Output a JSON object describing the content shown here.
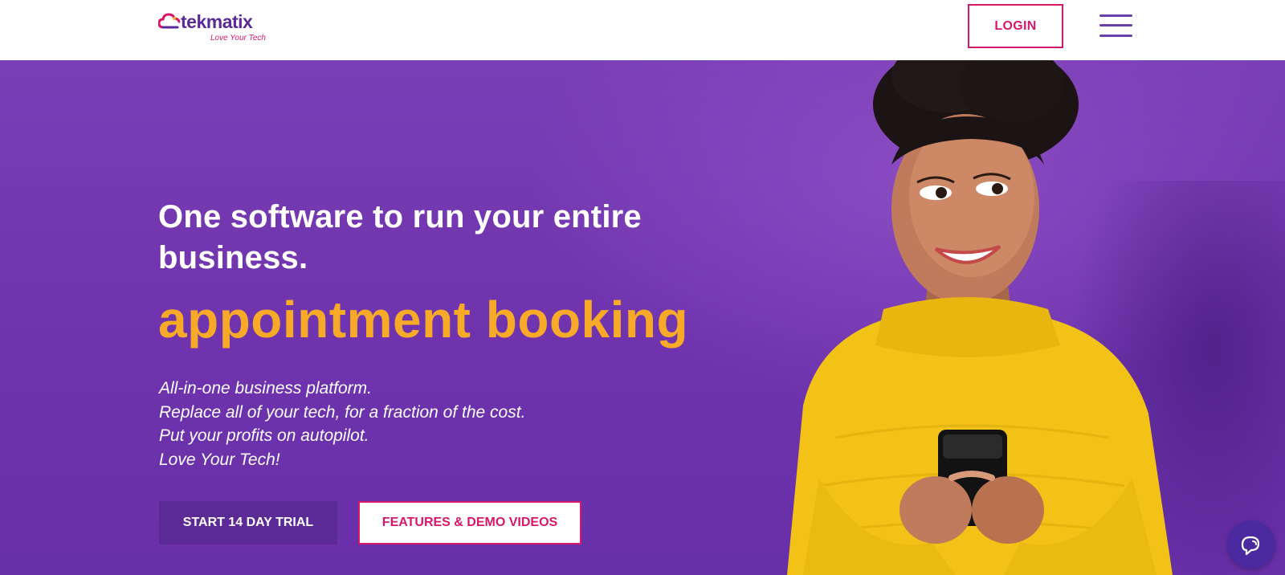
{
  "header": {
    "logo_text": "tekmatix",
    "logo_tagline": "Love Your Tech",
    "login_label": "LOGIN",
    "menu_icon": "hamburger-menu-icon"
  },
  "hero": {
    "headline": "One software to run your entire business.",
    "rotating_phrase": "appointment booking",
    "tagline_lines": [
      "All-in-one business platform.",
      "Replace all of your tech, for a fraction of the cost.",
      "Put your profits on autopilot.",
      "Love Your Tech!"
    ],
    "cta_primary": "START 14 DAY TRIAL",
    "cta_secondary": "FEATURES & DEMO VIDEOS"
  },
  "chat": {
    "icon": "chat-bubble-icon"
  },
  "colors": {
    "brand_purple": "#5b2a96",
    "hero_purple": "#7a3eb5",
    "accent_pink": "#d6176b",
    "accent_orange": "#f7a928",
    "sweater_yellow": "#f2c316"
  }
}
